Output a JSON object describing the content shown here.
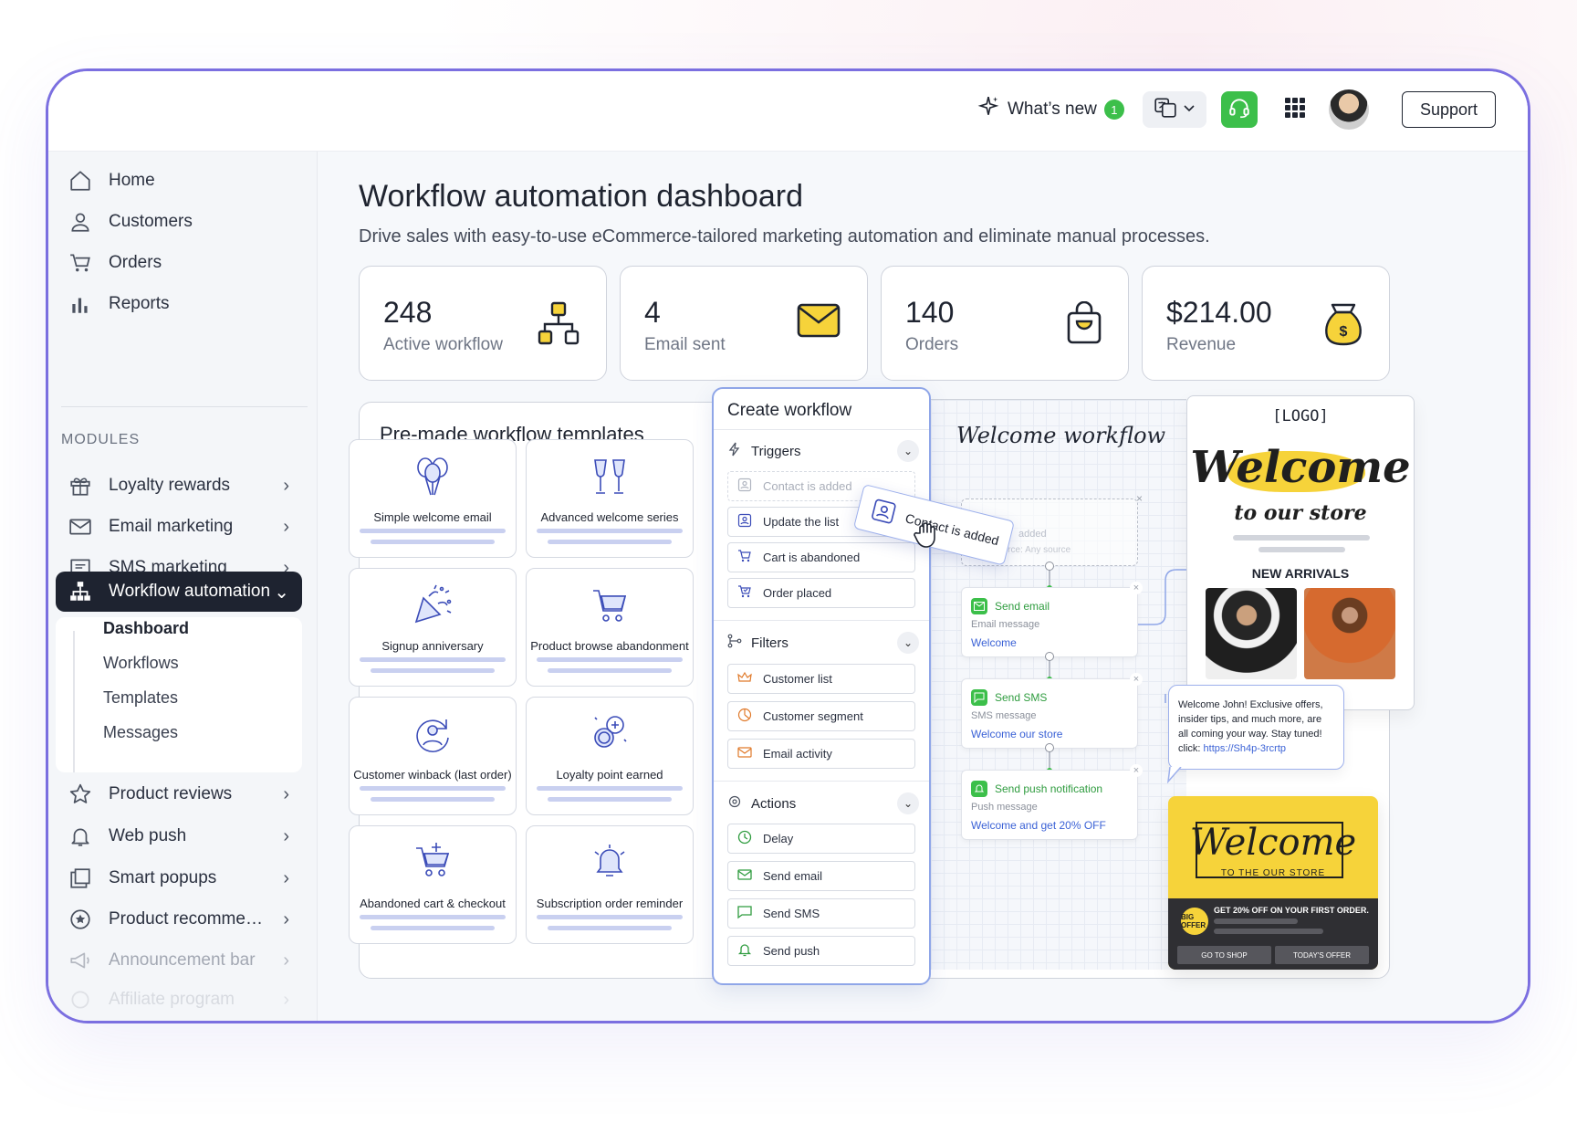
{
  "topbar": {
    "whats_new": "What’s new",
    "whats_new_count": "1",
    "support": "Support"
  },
  "sidebar": {
    "items": [
      {
        "label": "Home",
        "icon": "home-icon"
      },
      {
        "label": "Customers",
        "icon": "user-icon"
      },
      {
        "label": "Orders",
        "icon": "cart-icon"
      },
      {
        "label": "Reports",
        "icon": "bar-chart-icon"
      }
    ],
    "modules_label": "MODULES",
    "modules": [
      {
        "label": "Loyalty rewards",
        "icon": "gift-icon"
      },
      {
        "label": "Email marketing",
        "icon": "mail-icon"
      },
      {
        "label": "SMS marketing",
        "icon": "message-icon"
      },
      {
        "label": "Workflow automation",
        "icon": "workflow-icon"
      },
      {
        "label": "Product reviews",
        "icon": "star-icon"
      },
      {
        "label": "Web push",
        "icon": "bell-icon"
      },
      {
        "label": "Smart popups",
        "icon": "popup-icon"
      },
      {
        "label": "Product recomme…",
        "icon": "recommend-icon"
      },
      {
        "label": "Announcement bar",
        "icon": "megaphone-icon"
      },
      {
        "label": "Affiliate program",
        "icon": "affiliate-icon"
      }
    ],
    "sub_items": [
      "Dashboard",
      "Workflows",
      "Templates",
      "Messages"
    ]
  },
  "main": {
    "title": "Workflow automation dashboard",
    "subtitle": "Drive sales with easy-to-use eCommerce-tailored marketing automation and eliminate manual processes.",
    "stats": [
      {
        "value": "248",
        "label": "Active workflow",
        "icon": "workflow-icon"
      },
      {
        "value": "4",
        "label": "Email sent",
        "icon": "envelope-icon"
      },
      {
        "value": "140",
        "label": "Orders",
        "icon": "shopping-bag-icon"
      },
      {
        "value": "$214.00",
        "label": "Revenue",
        "icon": "money-bag-icon"
      }
    ],
    "templates_title": "Pre-made workflow templates",
    "templates": [
      "Simple welcome email",
      "Advanced welcome series",
      "Signup anniversary",
      "Product browse abandonment",
      "Customer winback (last order)",
      "Loyalty point earned",
      "Abandoned cart & checkout",
      "Subscription order reminder"
    ]
  },
  "create_workflow": {
    "title": "Create workflow",
    "triggers_label": "Triggers",
    "triggers": [
      "Contact is added",
      "Update the list",
      "Cart is abandoned",
      "Order placed"
    ],
    "filters_label": "Filters",
    "filters": [
      "Customer list",
      "Customer segment",
      "Email activity"
    ],
    "actions_label": "Actions",
    "actions": [
      "Delay",
      "Send email",
      "Send SMS",
      "Send push"
    ]
  },
  "canvas": {
    "title": "Welcome workflow",
    "dragging": "Contact is added",
    "ghost_text": "added",
    "ghost_source": "From source: Any source",
    "nodes": [
      {
        "title": "Send email",
        "sub": "Email message",
        "link": "Welcome"
      },
      {
        "title": "Send SMS",
        "sub": "SMS message",
        "link": "Welcome our store"
      },
      {
        "title": "Send push notification",
        "sub": "Push message",
        "link": "Welcome and get 20% OFF"
      }
    ]
  },
  "email_preview": {
    "logo": "[LOGO]",
    "welcome": "Welcome",
    "store": "to our store",
    "new_arrivals": "NEW ARRIVALS"
  },
  "sms_preview": {
    "text": "Welcome John! Exclusive offers, insider tips, and much more, are all coming your way. Stay tuned!  click:",
    "url": "https://Sh4p-3rcrtp"
  },
  "push_preview": {
    "welcome": "Welcome",
    "to_store": "TO THE OUR STORE",
    "badge": "BIG OFFER",
    "offer": "GET 20% OFF ON YOUR FIRST ORDER.",
    "btn_shop": "GO TO SHOP",
    "btn_offer": "TODAY'S OFFER"
  },
  "colors": {
    "accent": "#7b6fe0",
    "brand_green": "#3cbf4a",
    "active_nav": "#1e2330",
    "icon_yellow": "#f6d33a",
    "link_blue": "#3b62d6"
  }
}
